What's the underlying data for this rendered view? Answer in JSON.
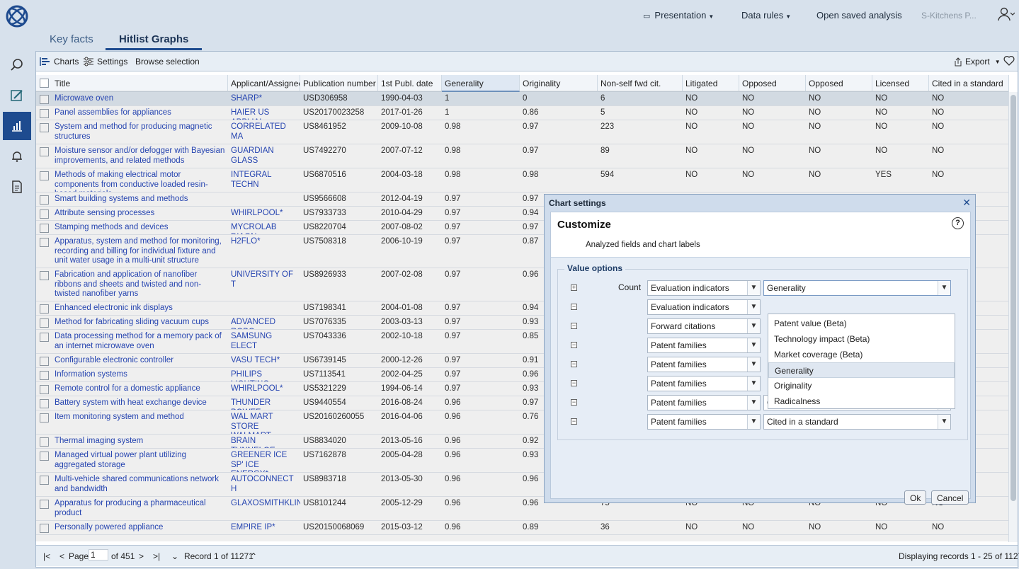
{
  "nav": {
    "presentation": "Presentation",
    "data_rules": "Data rules",
    "open_saved": "Open saved analysis",
    "user_name": "S-Kitchens P..."
  },
  "tabs": {
    "key_facts": "Key facts",
    "hitlist_graphs": "Hitlist Graphs"
  },
  "toolbar": {
    "charts": "Charts",
    "settings": "Settings",
    "browse": "Browse selection",
    "export": "Export"
  },
  "columns": [
    "Title",
    "Applicant/Assignee",
    "Publication number",
    "1st Publ. date",
    "Generality",
    "Originality",
    "Non-self fwd cit.",
    "Litigated",
    "Opposed",
    "Opposed",
    "Licensed",
    "Cited in a standard"
  ],
  "rows": [
    {
      "title": "Microwave oven",
      "applicant": "SHARP*",
      "pub": "USD306958",
      "date": "1990-04-03",
      "gen": "1",
      "orig": "0",
      "fwd": "6",
      "lit": "NO",
      "opp1": "NO",
      "opp2": "NO",
      "lic": "NO",
      "std": "NO"
    },
    {
      "title": "Panel assemblies for appliances",
      "applicant": "HAIER US APPLIAI",
      "pub": "US20170023258",
      "date": "2017-01-26",
      "gen": "1",
      "orig": "0.86",
      "fwd": "5",
      "lit": "NO",
      "opp1": "NO",
      "opp2": "NO",
      "lic": "NO",
      "std": "NO"
    },
    {
      "title": "System and method for producing magnetic structures",
      "applicant": "CORRELATED MA",
      "pub": "US8461952",
      "date": "2009-10-08",
      "gen": "0.98",
      "orig": "0.97",
      "fwd": "223",
      "lit": "NO",
      "opp1": "NO",
      "opp2": "NO",
      "lic": "NO",
      "std": "NO"
    },
    {
      "title": "Moisture sensor and/or defogger with Bayesian improvements, and related methods",
      "applicant": "GUARDIAN GLASS",
      "pub": "US7492270",
      "date": "2007-07-12",
      "gen": "0.98",
      "orig": "0.97",
      "fwd": "89",
      "lit": "NO",
      "opp1": "NO",
      "opp2": "NO",
      "lic": "NO",
      "std": "NO"
    },
    {
      "title": "Methods of making electrical motor components from conductive loaded resin-based materials",
      "applicant": "INTEGRAL TECHN",
      "pub": "US6870516",
      "date": "2004-03-18",
      "gen": "0.98",
      "orig": "0.98",
      "fwd": "594",
      "lit": "NO",
      "opp1": "NO",
      "opp2": "NO",
      "lic": "YES",
      "std": "NO"
    },
    {
      "title": "Smart building systems and methods",
      "applicant": "",
      "pub": "US9566608",
      "date": "2012-04-19",
      "gen": "0.97",
      "orig": "0.97",
      "fwd": "",
      "lit": "",
      "opp1": "",
      "opp2": "",
      "lic": "",
      "std": ""
    },
    {
      "title": "Attribute sensing processes",
      "applicant": "WHIRLPOOL*",
      "pub": "US7933733",
      "date": "2010-04-29",
      "gen": "0.97",
      "orig": "0.94",
      "fwd": "",
      "lit": "",
      "opp1": "",
      "opp2": "",
      "lic": "",
      "std": ""
    },
    {
      "title": "Stamping methods and devices",
      "applicant": "MYCROLAB DIAGN",
      "pub": "US8220704",
      "date": "2007-08-02",
      "gen": "0.97",
      "orig": "0.97",
      "fwd": "",
      "lit": "",
      "opp1": "",
      "opp2": "",
      "lic": "",
      "std": ""
    },
    {
      "title": "Apparatus, system and method for monitoring, recording and billing for individual fixture and unit water usage in a multi-unit structure",
      "applicant": "H2FLO*",
      "pub": "US7508318",
      "date": "2006-10-19",
      "gen": "0.97",
      "orig": "0.87",
      "fwd": "",
      "lit": "",
      "opp1": "",
      "opp2": "",
      "lic": "",
      "std": ""
    },
    {
      "title": "Fabrication and application of nanofiber ribbons and sheets and twisted and non-twisted nanofiber yarns",
      "applicant": "UNIVERSITY OF T",
      "pub": "US8926933",
      "date": "2007-02-08",
      "gen": "0.97",
      "orig": "0.96",
      "fwd": "",
      "lit": "",
      "opp1": "",
      "opp2": "",
      "lic": "",
      "std": ""
    },
    {
      "title": "Enhanced electronic ink displays",
      "applicant": "",
      "pub": "US7198341",
      "date": "2004-01-08",
      "gen": "0.97",
      "orig": "0.94",
      "fwd": "",
      "lit": "",
      "opp1": "",
      "opp2": "",
      "lic": "",
      "std": ""
    },
    {
      "title": "Method for fabricating sliding vacuum cups",
      "applicant": "ADVANCED ROBO",
      "pub": "US7076335",
      "date": "2003-03-13",
      "gen": "0.97",
      "orig": "0.93",
      "fwd": "",
      "lit": "",
      "opp1": "",
      "opp2": "",
      "lic": "",
      "std": ""
    },
    {
      "title": "Data processing method for a memory pack of an internet microwave oven",
      "applicant": "SAMSUNG ELECT",
      "pub": "US7043336",
      "date": "2002-10-18",
      "gen": "0.97",
      "orig": "0.85",
      "fwd": "",
      "lit": "",
      "opp1": "",
      "opp2": "",
      "lic": "",
      "std": ""
    },
    {
      "title": "Configurable electronic controller",
      "applicant": "VASU TECH*",
      "pub": "US6739145",
      "date": "2000-12-26",
      "gen": "0.97",
      "orig": "0.91",
      "fwd": "",
      "lit": "",
      "opp1": "",
      "opp2": "",
      "lic": "",
      "std": ""
    },
    {
      "title": "Information systems",
      "applicant": "PHILIPS LIGHTING",
      "pub": "US7113541",
      "date": "2002-04-25",
      "gen": "0.97",
      "orig": "0.96",
      "fwd": "",
      "lit": "",
      "opp1": "",
      "opp2": "",
      "lic": "",
      "std": ""
    },
    {
      "title": "Remote control for a domestic appliance",
      "applicant": "WHIRLPOOL*",
      "pub": "US5321229",
      "date": "1994-06-14",
      "gen": "0.97",
      "orig": "0.93",
      "fwd": "",
      "lit": "",
      "opp1": "",
      "opp2": "",
      "lic": "",
      "std": ""
    },
    {
      "title": "Battery system with heat exchange device",
      "applicant": "THUNDER POWEF",
      "pub": "US9440554",
      "date": "2016-08-24",
      "gen": "0.96",
      "orig": "0.97",
      "fwd": "",
      "lit": "",
      "opp1": "",
      "opp2": "",
      "lic": "",
      "std": ""
    },
    {
      "title": "Item monitoring system and method",
      "applicant": "WAL MART STORE WALMART APOLL(",
      "pub": "US20160260055",
      "date": "2016-04-06",
      "gen": "0.96",
      "orig": "0.76",
      "fwd": "",
      "lit": "",
      "opp1": "",
      "opp2": "",
      "lic": "",
      "std": ""
    },
    {
      "title": "Thermal imaging system",
      "applicant": "BRAIN TUNNELGE",
      "pub": "US8834020",
      "date": "2013-05-16",
      "gen": "0.96",
      "orig": "0.92",
      "fwd": "",
      "lit": "",
      "opp1": "",
      "opp2": "",
      "lic": "",
      "std": ""
    },
    {
      "title": "Managed virtual power plant utilizing aggregated storage",
      "applicant": "GREENER ICE SP' ICE ENERGY*",
      "pub": "US7162878",
      "date": "2005-04-28",
      "gen": "0.96",
      "orig": "0.93",
      "fwd": "",
      "lit": "",
      "opp1": "",
      "opp2": "",
      "lic": "",
      "std": ""
    },
    {
      "title": "Multi-vehicle shared communications network and bandwidth",
      "applicant": "AUTOCONNECT H",
      "pub": "US8983718",
      "date": "2013-05-30",
      "gen": "0.96",
      "orig": "0.96",
      "fwd": "",
      "lit": "",
      "opp1": "",
      "opp2": "",
      "lic": "",
      "std": ""
    },
    {
      "title": "Apparatus for producing a pharmaceutical product",
      "applicant": "GLAXOSMITHKLIN",
      "pub": "US8101244",
      "date": "2005-12-29",
      "gen": "0.96",
      "orig": "0.96",
      "fwd": "75",
      "lit": "NO",
      "opp1": "NO",
      "opp2": "NO",
      "lic": "NO",
      "std": "NO"
    },
    {
      "title": "Personally powered appliance",
      "applicant": "EMPIRE IP*",
      "pub": "US20150068069",
      "date": "2015-03-12",
      "gen": "0.96",
      "orig": "0.89",
      "fwd": "36",
      "lit": "NO",
      "opp1": "NO",
      "opp2": "NO",
      "lic": "NO",
      "std": "NO"
    }
  ],
  "footer": {
    "page_label": "Page",
    "page_value": "1",
    "of_pages": "of 451",
    "record": "Record 1 of 11271",
    "displaying": "Displaying records 1 - 25 of 11271"
  },
  "dialog": {
    "title": "Chart settings",
    "heading": "Customize",
    "subtitle": "Analyzed fields and chart labels",
    "help": "?",
    "legend": "Value options",
    "count_label": "Count",
    "value_rows": [
      {
        "field": "Evaluation indicators",
        "value": "Generality"
      },
      {
        "field": "Evaluation indicators",
        "value": ""
      },
      {
        "field": "Forward citations",
        "value": ""
      },
      {
        "field": "Patent families",
        "value": ""
      },
      {
        "field": "Patent families",
        "value": ""
      },
      {
        "field": "Patent families",
        "value": ""
      },
      {
        "field": "Patent families",
        "value": "Opposed"
      },
      {
        "field": "Patent families",
        "value": "Cited in a standard"
      }
    ],
    "dropdown_options": [
      "Patent value (Beta)",
      "Technology impact (Beta)",
      "Market coverage (Beta)",
      "Generality",
      "Originality",
      "Radicalness"
    ],
    "ok": "Ok",
    "cancel": "Cancel"
  },
  "colors": {
    "accent": "#1e4b8f",
    "link": "#1a3db8"
  }
}
